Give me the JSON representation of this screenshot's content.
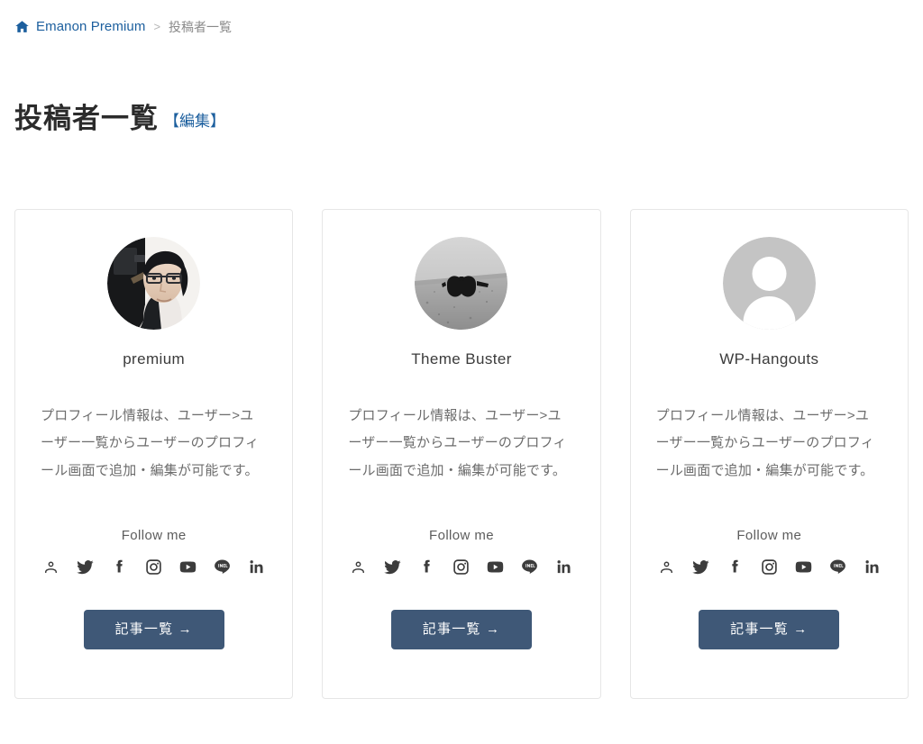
{
  "breadcrumb": {
    "home_icon": "home-icon",
    "site_label": "Emanon Premium",
    "separator": ">",
    "current": "投稿者一覧"
  },
  "page": {
    "title": "投稿者一覧",
    "edit_link": "【編集】"
  },
  "theme": {
    "link_color": "#1c5f9e",
    "button_bg": "#3f5877",
    "button_text": "#ffffff",
    "card_border": "#e6e6e6",
    "body_text": "#6c6c6c",
    "avatar_placeholder": "#c4c4c4"
  },
  "authors": [
    {
      "name": "premium",
      "avatar_type": "photo-portrait",
      "avatar_name": "avatar-premium",
      "bio": "プロフィール情報は、ユーザー>ユーザー一覧からユーザーのプロフィール画面で追加・編集が可能です。",
      "follow_label": "Follow me",
      "socials": [
        {
          "name": "website-icon",
          "label": "Website"
        },
        {
          "name": "twitter-icon",
          "label": "Twitter"
        },
        {
          "name": "facebook-icon",
          "label": "Facebook"
        },
        {
          "name": "instagram-icon",
          "label": "Instagram"
        },
        {
          "name": "youtube-icon",
          "label": "YouTube"
        },
        {
          "name": "line-icon",
          "label": "LINE"
        },
        {
          "name": "linkedin-icon",
          "label": "LinkedIn"
        }
      ],
      "button_label": "記事一覧 →"
    },
    {
      "name": "Theme Buster",
      "avatar_type": "photo-sunglasses",
      "avatar_name": "avatar-theme-buster",
      "bio": "プロフィール情報は、ユーザー>ユーザー一覧からユーザーのプロフィール画面で追加・編集が可能です。",
      "follow_label": "Follow me",
      "socials": [
        {
          "name": "website-icon",
          "label": "Website"
        },
        {
          "name": "twitter-icon",
          "label": "Twitter"
        },
        {
          "name": "facebook-icon",
          "label": "Facebook"
        },
        {
          "name": "instagram-icon",
          "label": "Instagram"
        },
        {
          "name": "youtube-icon",
          "label": "YouTube"
        },
        {
          "name": "line-icon",
          "label": "LINE"
        },
        {
          "name": "linkedin-icon",
          "label": "LinkedIn"
        }
      ],
      "button_label": "記事一覧 →"
    },
    {
      "name": "WP-Hangouts",
      "avatar_type": "placeholder-silhouette",
      "avatar_name": "avatar-wp-hangouts",
      "bio": "プロフィール情報は、ユーザー>ユーザー一覧からユーザーのプロフィール画面で追加・編集が可能です。",
      "follow_label": "Follow me",
      "socials": [
        {
          "name": "website-icon",
          "label": "Website"
        },
        {
          "name": "twitter-icon",
          "label": "Twitter"
        },
        {
          "name": "facebook-icon",
          "label": "Facebook"
        },
        {
          "name": "instagram-icon",
          "label": "Instagram"
        },
        {
          "name": "youtube-icon",
          "label": "YouTube"
        },
        {
          "name": "line-icon",
          "label": "LINE"
        },
        {
          "name": "linkedin-icon",
          "label": "LinkedIn"
        }
      ],
      "button_label": "記事一覧 →"
    }
  ]
}
